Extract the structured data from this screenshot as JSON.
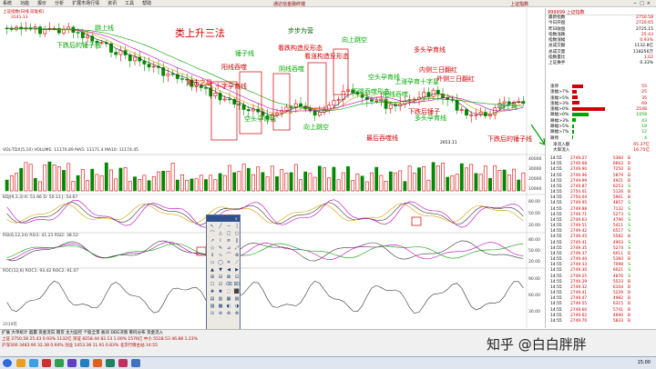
{
  "menubar": {
    "items": [
      "系统",
      "功能",
      "报价",
      "分析",
      "扩展市场行情",
      "资讯",
      "工具",
      "帮助"
    ],
    "center_title": "通达信金融终端",
    "right_title": "上证指数"
  },
  "chart": {
    "top_label": "上证指数(日线 前复权)",
    "high_mark": "3141.13",
    "low_mark": "2653.11",
    "volume_label": "VOL-TDX(5,10) VOLUME: 11170.89 MA5: 11171.4  MA10: 11174.45",
    "indicator1_label": "KDJ(9,3,3) K: 51.66 D: 50.13 J: 54.67",
    "indicator2_label": "RSI(6,12,24) RSI1: 41.21 RSI2: 38.52",
    "indicator3_label": "ROC(12,6) ROC1: 93.42 ROC2: 91.07",
    "vol_axis": [
      "40000",
      "30000",
      "20000",
      "10000"
    ],
    "kdj_axis": [
      "80.00",
      "50.00",
      "20.00"
    ],
    "rsi_axis": [
      "80.00",
      "50.00",
      "20.00"
    ],
    "roc_axis": [
      "90.00",
      "60.00",
      "30.00"
    ],
    "date_label": "2019年"
  },
  "annotations": {
    "title_pattern": "类上升三法",
    "a1": "下跌后的锤子线",
    "a2": "射击之星",
    "a3": "锤子线",
    "a4": "阳线吞噬",
    "a5": "步步为营",
    "a6": "看涨构造反形态",
    "a7": "向上跳空",
    "a8": "多头孕育线",
    "a9": "空头孕育线",
    "a10": "十字孕育线",
    "a11": "下降吞噬形态",
    "a12": "阳线吞噬",
    "a13": "上涨孕育十字星",
    "a14": "向上跳空",
    "a15": "外侧三日翻红",
    "a16": "内侧三日翻红",
    "a17": "最后吞噬线",
    "a18": "下跌后的锤子线",
    "a19": "跳上线",
    "a20": "空头孕育线",
    "a21": "多头孕育线",
    "a22": "下跌后锤子",
    "a23": "阴线吞噬",
    "a24": "看跌构造反形态",
    "a25": "跳上线"
  },
  "right_panel": {
    "title": "999999 上证指数",
    "stats": [
      {
        "label": "最新指数",
        "value": "2750.58",
        "cls": "up"
      },
      {
        "label": "今日开盘",
        "value": "2720.65",
        "cls": "up"
      },
      {
        "label": "昨日收盘",
        "value": "2725.15",
        "cls": "nt"
      },
      {
        "label": "指数涨跌",
        "value": "25.43",
        "cls": "up"
      },
      {
        "label": "指数涨幅",
        "value": "0.93%",
        "cls": "up"
      },
      {
        "label": "总成交额",
        "value": "1132.8亿",
        "cls": "nt"
      },
      {
        "label": "总成交量",
        "value": "118256万",
        "cls": "nt"
      },
      {
        "label": "指数量比",
        "value": "1.02",
        "cls": "up"
      },
      {
        "label": "上证换手",
        "value": "0.33%",
        "cls": "nt"
      }
    ],
    "orderbook": [
      {
        "label": "涨停",
        "pct": 20,
        "val": "55",
        "color": "#d00000"
      },
      {
        "label": "涨幅>7%",
        "pct": 8,
        "val": "25",
        "color": "#d00000"
      },
      {
        "label": "涨幅>5%",
        "pct": 10,
        "val": "35",
        "color": "#d00000"
      },
      {
        "label": "涨幅>3%",
        "pct": 14,
        "val": "69",
        "color": "#d00000"
      },
      {
        "label": "涨幅>0%",
        "pct": 60,
        "val": "2548",
        "color": "#d00000"
      },
      {
        "label": "跌幅>0%",
        "pct": 30,
        "val": "1058",
        "color": "#00a000"
      },
      {
        "label": "跌幅>3%",
        "pct": 6,
        "val": "43",
        "color": "#00a000"
      },
      {
        "label": "跌幅>5%",
        "pct": 4,
        "val": "18",
        "color": "#00a000"
      },
      {
        "label": "跌幅>7%",
        "pct": 3,
        "val": "12",
        "color": "#00a000"
      },
      {
        "label": "跌停",
        "pct": 2,
        "val": "4",
        "color": "#00a000"
      }
    ],
    "summary": [
      {
        "label": "净流入额",
        "value": "65.37亿",
        "cls": "up"
      },
      {
        "label": "大单流入",
        "value": "16.75亿",
        "cls": "up"
      }
    ],
    "ticks": [
      {
        "t": "14:55",
        "p": "2749.27",
        "v": "5360",
        "d": "B"
      },
      {
        "t": "14:55",
        "p": "2749.68",
        "v": "6663",
        "d": "B"
      },
      {
        "t": "14:55",
        "p": "2749.90",
        "v": "7250",
        "d": "B"
      },
      {
        "t": "14:55",
        "p": "2749.96",
        "v": "5879",
        "d": "B"
      },
      {
        "t": "14:55",
        "p": "2749.99",
        "v": "4921",
        "d": "B"
      },
      {
        "t": "14:55",
        "p": "2749.87",
        "v": "6253",
        "d": "S"
      },
      {
        "t": "14:55",
        "p": "2750.01",
        "v": "5126",
        "d": "B"
      },
      {
        "t": "14:55",
        "p": "2750.04",
        "v": "5961",
        "d": "B"
      },
      {
        "t": "14:55",
        "p": "2749.95",
        "v": "4857",
        "d": "S"
      },
      {
        "t": "14:55",
        "p": "2749.88",
        "v": "7132",
        "d": "S"
      },
      {
        "t": "14:55",
        "p": "2749.71",
        "v": "5273",
        "d": "S"
      },
      {
        "t": "14:55",
        "p": "2749.63",
        "v": "4796",
        "d": "S"
      },
      {
        "t": "14:55",
        "p": "2749.51",
        "v": "5411",
        "d": "S"
      },
      {
        "t": "14:55",
        "p": "2749.42",
        "v": "6517",
        "d": "S"
      },
      {
        "t": "14:55",
        "p": "2749.45",
        "v": "5582",
        "d": "B"
      },
      {
        "t": "14:55",
        "p": "2749.41",
        "v": "4903",
        "d": "S"
      },
      {
        "t": "14:55",
        "p": "2749.35",
        "v": "5274",
        "d": "S"
      },
      {
        "t": "14:55",
        "p": "2749.37",
        "v": "6011",
        "d": "B"
      },
      {
        "t": "14:55",
        "p": "2749.40",
        "v": "5360",
        "d": "B"
      },
      {
        "t": "14:55",
        "p": "2749.33",
        "v": "7098",
        "d": "S"
      },
      {
        "t": "14:55",
        "p": "2749.30",
        "v": "6021",
        "d": "S"
      },
      {
        "t": "14:55",
        "p": "2749.25",
        "v": "4876",
        "d": "S"
      },
      {
        "t": "14:55",
        "p": "2749.29",
        "v": "5533",
        "d": "B"
      },
      {
        "t": "14:55",
        "p": "2749.32",
        "v": "6104",
        "d": "B"
      },
      {
        "t": "14:55",
        "p": "2749.41",
        "v": "5229",
        "d": "B"
      },
      {
        "t": "14:55",
        "p": "2749.47",
        "v": "4982",
        "d": "B"
      },
      {
        "t": "14:55",
        "p": "2749.55",
        "v": "6315",
        "d": "B"
      },
      {
        "t": "14:55",
        "p": "2749.60",
        "v": "5741",
        "d": "B"
      },
      {
        "t": "14:55",
        "p": "2749.62",
        "v": "4690",
        "d": "B"
      },
      {
        "t": "14:55",
        "p": "2749.70",
        "v": "5833",
        "d": "B"
      }
    ]
  },
  "status": {
    "line1": "扩展  大单统计  超赢  资金流向  期货  主力监控  个股全景  板块  DDE决策  筹码分布  资金流入",
    "line2": "上证 2750.58  25.43  0.93%  1132亿  深证 8258.44  82.13  1.00%  1576亿  中小 5518.53  46.88  1.23%",
    "line3": "沪深300 3483.90  32.38  0.94%  创业 1453.38  11.91  0.83%  北京行情主站  14:55"
  },
  "watermark": "知乎 @白白胖胖",
  "taskbar": {
    "clock": "15:00"
  }
}
